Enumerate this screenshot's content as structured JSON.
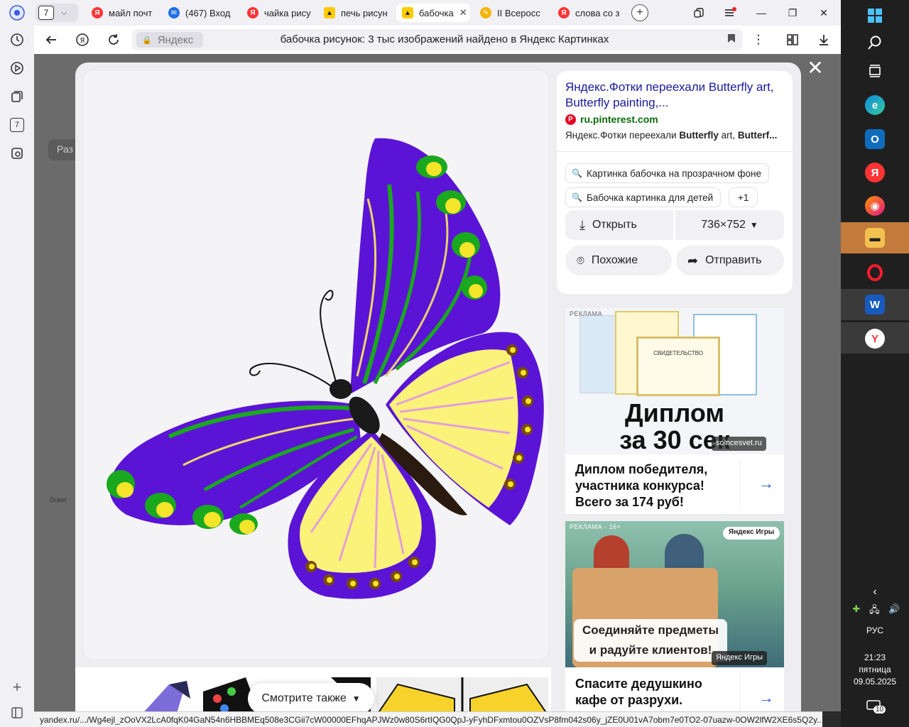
{
  "tabs": {
    "count": "7",
    "items": [
      {
        "label": "майл почт",
        "icon": "yandex-icon",
        "color": "#f33"
      },
      {
        "label": "(467) Вход",
        "icon": "mail-icon",
        "color": "#1e6fe8"
      },
      {
        "label": "чайка рису",
        "icon": "yandex-icon",
        "color": "#f33"
      },
      {
        "label": "печь рисун",
        "icon": "images-icon",
        "color": "#fc0"
      },
      {
        "label": "бабочка",
        "icon": "images-icon",
        "color": "#fc0"
      },
      {
        "label": "II Всеросс",
        "icon": "site-icon",
        "color": "#f5b400"
      },
      {
        "label": "слова со з",
        "icon": "yandex-icon",
        "color": "#f33"
      }
    ]
  },
  "address": {
    "site": "Яндекс",
    "title": "бабочка рисунок: 3 тыс изображений найдено в Яндекс Картинках"
  },
  "sidepanel_tab_badge": "7",
  "info": {
    "title": "Яндекс.Фотки переехали Butterfly art, Butterfly painting,...",
    "source": "ru.pinterest.com",
    "snippet_pre": "Яндекс.Фотки переехали ",
    "snippet_b1": "Butterfly",
    "snippet_mid": " art, ",
    "snippet_b2": "Butterf...",
    "chips": [
      "Картинка бабочка на прозрачном фоне",
      "Бабочка картинка для детей",
      "+1"
    ],
    "open_label": "Открыть",
    "size_label": "736×752",
    "similar_label": "Похожие",
    "share_label": "Отправить"
  },
  "ad1": {
    "label": "РЕКЛАМА",
    "image_text": "Диплом за 30 сек",
    "image_text_line1": "Диплом",
    "image_text_line2": "за 30 сек",
    "cert_text": "СВИДЕТЕЛЬСТВО",
    "domain": "solncesvet.ru",
    "text_line1": "Диплом победителя,",
    "text_line2": "участника конкурса!",
    "text_line3": "Всего за 174 руб!"
  },
  "ad2": {
    "label": "РЕКЛАМА · 16+",
    "brand": "Яндекс Игры",
    "image_line1": "Соединяйте предметы",
    "image_line2": "и радуйте клиентов!",
    "brand_bottom": "Яндекс Игры",
    "text_line1": "Спасите дедушкино",
    "text_line2": "кафе от разрухи."
  },
  "see_also": "Смотрите также",
  "status_url": "yandex.ru/.../Wg4ejl_zOoVX2LcA0fqK04GaN54n6HBBMEq508e3CGii7cW00000EFhqAPJWz0w80S6rtIQG0QpJ-yFyhDFxmtou0OZVsP8fm042s06y_jZE0U01vA7obm7e0TO2-07uazw-0OW2lfW2XE6s5Q2y...",
  "background_peek": {
    "tab_label": "Раз",
    "drawing_label": "Drawi"
  },
  "taskbar": {
    "lang": "РУС",
    "time": "21:23",
    "weekday": "пятница",
    "date": "09.05.2025",
    "notifications": "10"
  },
  "colors": {
    "butterfly_purple": "#5b14d6",
    "butterfly_yellow": "#fbf27a",
    "butterfly_green": "#1aa81e",
    "link_blue": "#1a1a9c",
    "source_green": "#0b6b0b",
    "accent_arrow": "#1a5bd6"
  }
}
